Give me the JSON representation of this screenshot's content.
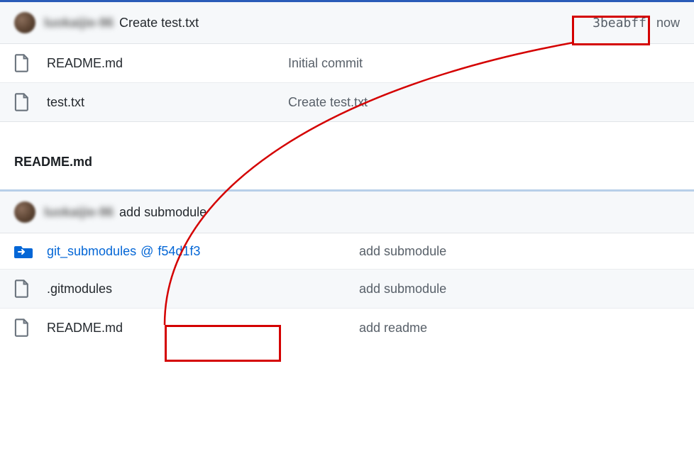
{
  "repo1": {
    "header": {
      "username": "luokaijie-96",
      "commit_message": "Create test.txt",
      "sha": "3beabff",
      "time": "now"
    },
    "files": [
      {
        "type": "file",
        "name": "README.md",
        "message": "Initial commit"
      },
      {
        "type": "file",
        "name": "test.txt",
        "message": "Create test.txt"
      }
    ],
    "readme_heading": "README.md"
  },
  "repo2": {
    "header": {
      "username": "luokaijie-96",
      "commit_message": "add submodule"
    },
    "files": [
      {
        "type": "submodule",
        "name": "git_submodules",
        "at": "@",
        "hash": "f54d1f3",
        "message": "add submodule"
      },
      {
        "type": "file",
        "name": ".gitmodules",
        "message": "add submodule"
      },
      {
        "type": "file",
        "name": "README.md",
        "message": "add readme"
      }
    ]
  }
}
